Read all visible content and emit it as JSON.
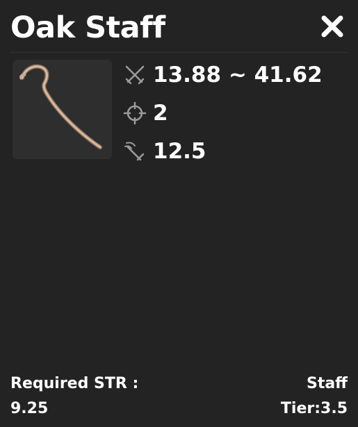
{
  "item": {
    "name": "Oak Staff",
    "image": "oak-staff-image"
  },
  "stats": {
    "damage": {
      "icon": "swords-icon",
      "value": "13.88 ~ 41.62"
    },
    "range": {
      "icon": "crosshair-icon",
      "value": "2"
    },
    "speed": {
      "icon": "attack-speed-icon",
      "value": "12.5"
    }
  },
  "footer": {
    "required_label": "Required STR :",
    "required_value": "9.25",
    "type": "Staff",
    "tier": "Tier:3.5"
  },
  "icons": {
    "close": "close-icon"
  },
  "colors": {
    "background": "#232323",
    "item_box": "#2e2e2e",
    "icon_gray": "#9a9a9a",
    "text": "#ffffff"
  }
}
